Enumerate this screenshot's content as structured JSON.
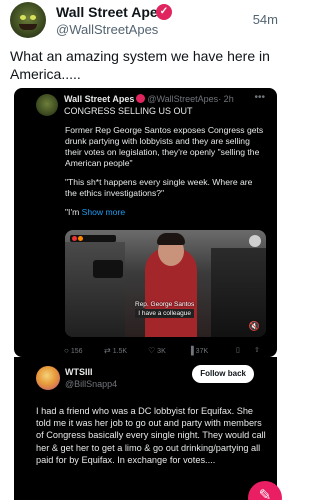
{
  "post": {
    "author_name": "Wall Street Apes",
    "author_handle": "@WallStreetApes",
    "time": "54m",
    "text": "What an amazing system we have here in America.....",
    "verified_icon": "verified-badge-icon"
  },
  "quoted": {
    "author_name": "Wall Street Apes",
    "author_handle": "@WallStreetApes",
    "time": "· 2h",
    "first_line": "CONGRESS SELLING US OUT",
    "paragraphs": [
      "Former Rep George Santos exposes Congress gets drunk partying with lobbyists and they are selling their votes on legislation, they're openly \"selling the American people\"",
      "\"This sh*t happens every single week. Where are the ethics investigations?\""
    ],
    "truncated_text": "\"I'm",
    "show_more": "Show more",
    "video": {
      "caption_line1": "Rep. George Santos",
      "caption_line2": "I have a colleague"
    },
    "stats": {
      "replies": "156",
      "retweets": "1.5K",
      "likes": "3K",
      "views": "37K"
    }
  },
  "reply": {
    "author_name": "WTSIII",
    "author_handle": "@BillSnapp4",
    "follow_label": "Follow back",
    "text": "I had a friend who was a DC lobbyist for Equifax. She told me it was her job to go out and party with members of Congress basically every single night. They would call her & get her to get a limo & go out drinking/partying all paid for by Equifax. In exchange for votes...."
  },
  "colors": {
    "accent": "#1d9bf0",
    "fab": "#e91e63",
    "verified": "#e0245e"
  }
}
